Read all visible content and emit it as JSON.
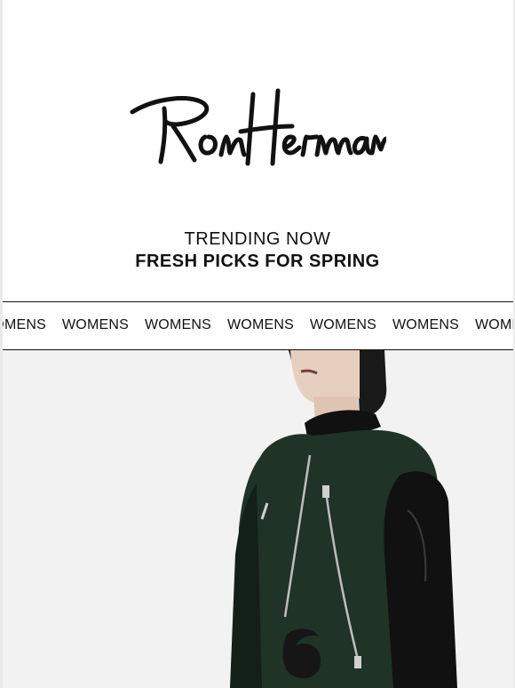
{
  "brand": {
    "logo_text": "Ron Herman"
  },
  "headline": {
    "line1": "TRENDING NOW",
    "line2": "FRESH PICKS FOR SPRING"
  },
  "marquee": {
    "items": [
      "WOMENS",
      "WOMENS",
      "WOMENS",
      "WOMENS",
      "WOMENS",
      "WOMENS",
      "WOMENS"
    ]
  },
  "hero": {
    "image": "model-wearing-green-varsity-jacket-with-black-leather-sleeves",
    "jacket_color": "#1f3327",
    "sleeve_color": "#111111",
    "background_color": "#f2f2f2"
  }
}
